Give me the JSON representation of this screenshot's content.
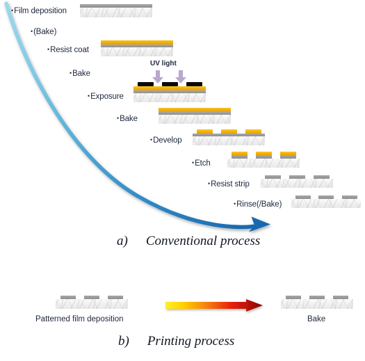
{
  "figure": {
    "background_color": "#ffffff",
    "sections": [
      {
        "id": "conventional",
        "caption_letter": "a)",
        "caption_text": "Conventional process"
      },
      {
        "id": "printing",
        "caption_letter": "b)",
        "caption_text": "Printing process"
      }
    ]
  },
  "conventional": {
    "steps": [
      {
        "bullet": "•",
        "label": "Film deposition"
      },
      {
        "bullet": "•",
        "label": "(Bake)"
      },
      {
        "bullet": "•",
        "label": "Resist coat"
      },
      {
        "bullet": "•",
        "label": "Bake"
      },
      {
        "bullet": "•",
        "label": "Exposure"
      },
      {
        "bullet": "•",
        "label": "Bake"
      },
      {
        "bullet": "•",
        "label": "Develop"
      },
      {
        "bullet": "•",
        "label": "Etch"
      },
      {
        "bullet": "•",
        "label": "Resist strip"
      },
      {
        "bullet": "•",
        "label": "Rinse(/Bake)"
      }
    ],
    "uv_light_label": "UV light",
    "arrow": {
      "name": "process-flow-arrow",
      "color_start": "#8ed2e8",
      "color_end": "#1f72b8"
    },
    "colors": {
      "substrate": "#f1f1f1",
      "film_gray": "#9b9b9b",
      "resist_yellow": "#f0ad0c",
      "mask_black": "#0a0a0a",
      "uv_arrow_purple": "#b9a8ce"
    },
    "caption_letter": "a)",
    "caption_text": "Conventional process"
  },
  "printing": {
    "left_label": "Patterned film deposition",
    "right_label": "Bake",
    "arrow": {
      "name": "heat-gradient-arrow",
      "color_start": "#ffe800",
      "color_mid": "#f07c0c",
      "color_end": "#8c0f0a"
    },
    "caption_letter": "b)",
    "caption_text": "Printing process"
  }
}
